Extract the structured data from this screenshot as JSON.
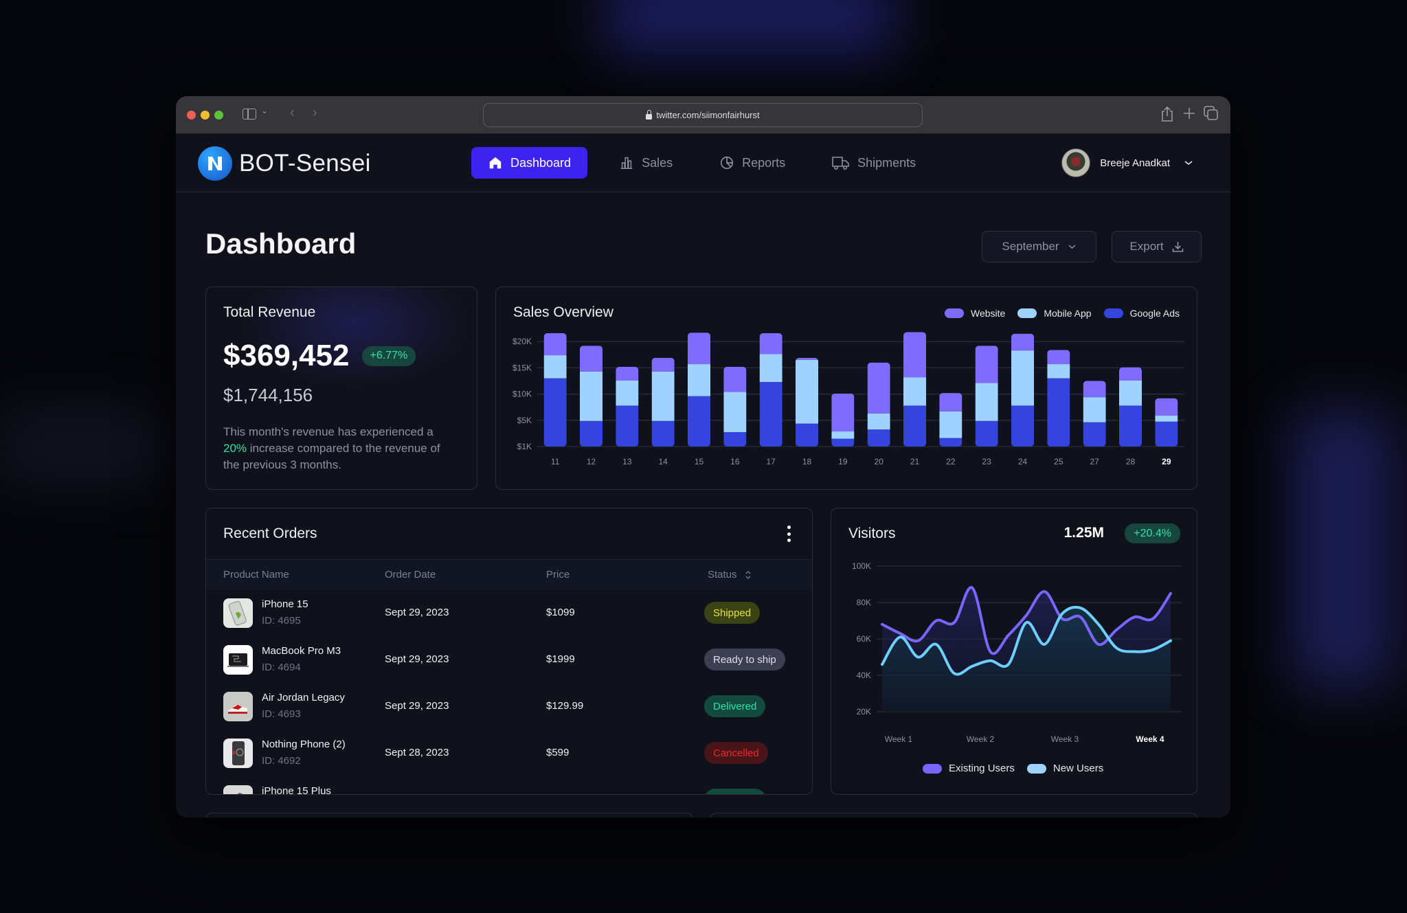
{
  "browser": {
    "url": "twitter.com/siimonfairhurst"
  },
  "app": {
    "name": "BOT-Sensei",
    "nav": [
      {
        "label": "Dashboard",
        "icon": "home-icon",
        "active": true
      },
      {
        "label": "Sales",
        "icon": "bar-chart-icon",
        "active": false
      },
      {
        "label": "Reports",
        "icon": "pie-chart-icon",
        "active": false
      },
      {
        "label": "Shipments",
        "icon": "truck-icon",
        "active": false
      }
    ],
    "user": {
      "name": "Breeje Anadkat"
    }
  },
  "page": {
    "title": "Dashboard",
    "month_select": "September",
    "export_label": "Export"
  },
  "revenue": {
    "title": "Total Revenue",
    "amount": "$369,452",
    "change": "+6.77%",
    "secondary": "$1,744,156",
    "desc_pre": "This month's revenue has experienced a ",
    "desc_highlight": "20%",
    "desc_post": " increase compared to the revenue of the previous 3 months."
  },
  "colors": {
    "website": "#7f6cff",
    "mobile_app": "#a0d2ff",
    "google_ads": "#3444dc",
    "existing_users": "#7866ff",
    "new_users": "#6dcfff",
    "accent": "#3d22f0",
    "positive": "#2fe3a6"
  },
  "chart_data": [
    {
      "type": "bar",
      "stacked": true,
      "title": "Sales Overview",
      "categories": [
        "11",
        "12",
        "13",
        "14",
        "15",
        "16",
        "17",
        "18",
        "19",
        "20",
        "21",
        "22",
        "23",
        "24",
        "25",
        "27",
        "28",
        "29"
      ],
      "highlighted_category": "29",
      "y_ticks": [
        "$1K",
        "$5K",
        "$10K",
        "$15K",
        "$20K"
      ],
      "y_tick_values": [
        1,
        5,
        10,
        15,
        20
      ],
      "y_unit": "thousands USD",
      "legend_position": "top-right",
      "grid": true,
      "series": [
        {
          "name": "Google Ads",
          "values": [
            12.0,
            3.9,
            6.8,
            3.9,
            8.6,
            2.2,
            11.3,
            3.5,
            1.2,
            2.6,
            6.8,
            1.3,
            3.9,
            6.8,
            12.0,
            3.7,
            6.8,
            3.8
          ]
        },
        {
          "name": "Mobile App",
          "values": [
            4.4,
            9.4,
            4.8,
            9.4,
            6.1,
            7.2,
            5.3,
            12.0,
            1.1,
            2.7,
            5.4,
            4.4,
            7.2,
            10.5,
            2.7,
            4.7,
            4.8,
            1.1
          ]
        },
        {
          "name": "Website",
          "values": [
            4.2,
            4.9,
            2.6,
            2.6,
            6.0,
            4.8,
            4.0,
            0.4,
            6.8,
            9.7,
            8.6,
            3.5,
            7.1,
            3.2,
            2.7,
            3.1,
            2.5,
            3.3
          ]
        }
      ]
    },
    {
      "type": "line",
      "title": "Visitors",
      "total": "1.25M",
      "change": "+20.4%",
      "x_labels": [
        "Week 1",
        "Week 2",
        "Week 3",
        "Week 4"
      ],
      "highlighted_x_label": "Week 4",
      "y_ticks": [
        "20K",
        "40K",
        "60K",
        "80K",
        "100K"
      ],
      "ylim": [
        20,
        100
      ],
      "y_unit": "thousands",
      "legend_position": "bottom-center",
      "grid": true,
      "x": [
        0,
        0.25,
        0.5,
        0.75,
        1,
        1.25,
        1.5,
        1.75,
        2,
        2.25,
        2.5,
        2.75,
        3,
        3.25,
        3.5,
        3.75,
        4
      ],
      "series": [
        {
          "name": "Existing Users",
          "values": [
            68,
            63,
            59,
            70,
            69,
            88,
            53,
            62,
            73,
            86,
            71,
            72,
            57,
            65,
            72,
            71,
            85
          ]
        },
        {
          "name": "New Users",
          "values": [
            46,
            61,
            50,
            57,
            41,
            45,
            48,
            46,
            69,
            57,
            74,
            77,
            68,
            55,
            53,
            54,
            59
          ]
        }
      ]
    }
  ],
  "orders": {
    "title": "Recent Orders",
    "columns": [
      "Product Name",
      "Order Date",
      "Price",
      "Status"
    ],
    "rows": [
      {
        "name": "iPhone 15",
        "id": "ID: 4695",
        "date": "Sept 29, 2023",
        "price": "$1099",
        "status": "Shipped",
        "status_type": "shipped",
        "thumb": "phone"
      },
      {
        "name": "MacBook Pro M3",
        "id": "ID: 4694",
        "date": "Sept 29, 2023",
        "price": "$1999",
        "status": "Ready to ship",
        "status_type": "ready",
        "thumb": "laptop"
      },
      {
        "name": "Air Jordan Legacy",
        "id": "ID: 4693",
        "date": "Sept 29, 2023",
        "price": "$129.99",
        "status": "Delivered",
        "status_type": "delivered",
        "thumb": "shoe"
      },
      {
        "name": "Nothing Phone (2)",
        "id": "ID: 4692",
        "date": "Sept 28, 2023",
        "price": "$599",
        "status": "Cancelled",
        "status_type": "cancelled",
        "thumb": "nothing"
      },
      {
        "name": "iPhone 15 Plus",
        "id": "",
        "date": "",
        "price": "",
        "status": "",
        "status_type": "delivered",
        "thumb": "phone2"
      }
    ]
  }
}
